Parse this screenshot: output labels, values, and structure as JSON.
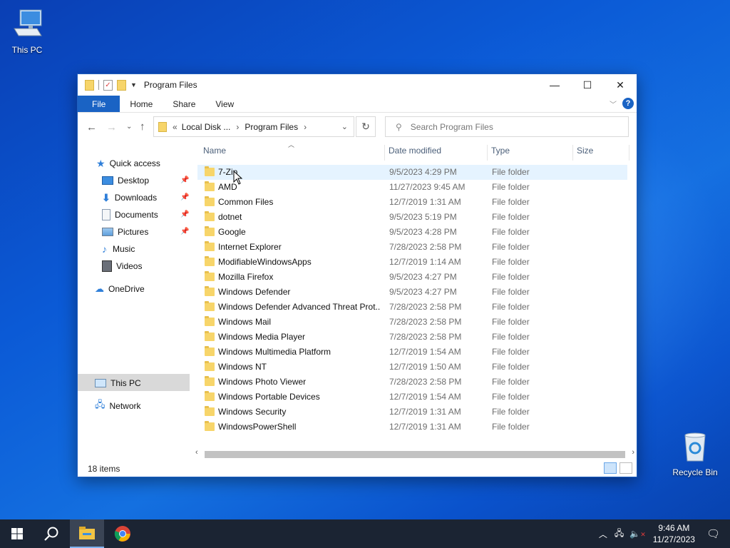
{
  "desktop": {
    "icons": [
      {
        "label": "This PC",
        "icon": "computer-icon"
      },
      {
        "label": "Recycle Bin",
        "icon": "recycle-bin-icon"
      }
    ]
  },
  "window": {
    "title": "Program Files",
    "controls": {
      "minimize": "—",
      "maximize": "☐",
      "close": "✕"
    },
    "ribbon_tabs": [
      "File",
      "Home",
      "Share",
      "View"
    ],
    "help": "?",
    "address": {
      "prefix": "«",
      "segments": [
        "Local Disk ...",
        "Program Files"
      ]
    },
    "search_placeholder": "Search Program Files",
    "nav_pane": {
      "quick_access": "Quick access",
      "pinned": [
        "Desktop",
        "Downloads",
        "Documents",
        "Pictures"
      ],
      "unpinned": [
        "Music",
        "Videos"
      ],
      "onedrive": "OneDrive",
      "this_pc": "This PC",
      "network": "Network"
    },
    "columns": {
      "name": "Name",
      "date": "Date modified",
      "type": "Type",
      "size": "Size"
    },
    "files": [
      {
        "name": "7-Zip",
        "date": "9/5/2023 4:29 PM",
        "type": "File folder"
      },
      {
        "name": "AMD",
        "date": "11/27/2023 9:45 AM",
        "type": "File folder"
      },
      {
        "name": "Common Files",
        "date": "12/7/2019 1:31 AM",
        "type": "File folder"
      },
      {
        "name": "dotnet",
        "date": "9/5/2023 5:19 PM",
        "type": "File folder"
      },
      {
        "name": "Google",
        "date": "9/5/2023 4:28 PM",
        "type": "File folder"
      },
      {
        "name": "Internet Explorer",
        "date": "7/28/2023 2:58 PM",
        "type": "File folder"
      },
      {
        "name": "ModifiableWindowsApps",
        "date": "12/7/2019 1:14 AM",
        "type": "File folder"
      },
      {
        "name": "Mozilla Firefox",
        "date": "9/5/2023 4:27 PM",
        "type": "File folder"
      },
      {
        "name": "Windows Defender",
        "date": "9/5/2023 4:27 PM",
        "type": "File folder"
      },
      {
        "name": "Windows Defender Advanced Threat Prot...",
        "date": "7/28/2023 2:58 PM",
        "type": "File folder"
      },
      {
        "name": "Windows Mail",
        "date": "7/28/2023 2:58 PM",
        "type": "File folder"
      },
      {
        "name": "Windows Media Player",
        "date": "7/28/2023 2:58 PM",
        "type": "File folder"
      },
      {
        "name": "Windows Multimedia Platform",
        "date": "12/7/2019 1:54 AM",
        "type": "File folder"
      },
      {
        "name": "Windows NT",
        "date": "12/7/2019 1:50 AM",
        "type": "File folder"
      },
      {
        "name": "Windows Photo Viewer",
        "date": "7/28/2023 2:58 PM",
        "type": "File folder"
      },
      {
        "name": "Windows Portable Devices",
        "date": "12/7/2019 1:54 AM",
        "type": "File folder"
      },
      {
        "name": "Windows Security",
        "date": "12/7/2019 1:31 AM",
        "type": "File folder"
      },
      {
        "name": "WindowsPowerShell",
        "date": "12/7/2019 1:31 AM",
        "type": "File folder"
      }
    ],
    "status": "18 items"
  },
  "taskbar": {
    "time": "9:46 AM",
    "date": "11/27/2023",
    "accent": "#1a63c4"
  }
}
